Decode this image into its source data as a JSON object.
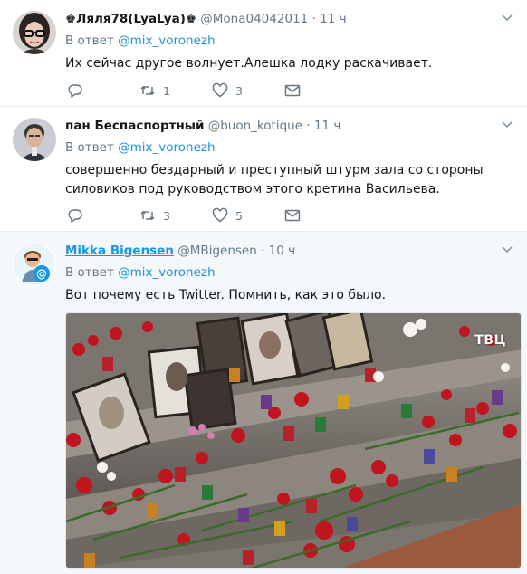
{
  "colors": {
    "accent": "#1b95e0",
    "muted": "#657786",
    "text": "#14171a",
    "border": "#e6ecf0",
    "highlight_bg": "#f5f8fa"
  },
  "tweets": [
    {
      "name": "♚Ляля78(LyaLya)♚",
      "handle": "@Mona04042011",
      "dot": "·",
      "time": "11 ч",
      "reply_prefix": "В ответ",
      "reply_mention": "@mix_voronezh",
      "text": "Их сейчас другое волнует.Алешка лодку раскачивает.",
      "retweets": "1",
      "likes": "3"
    },
    {
      "name": "пан Беспаспортный",
      "handle": "@buon_kotique",
      "dot": "·",
      "time": "11 ч",
      "reply_prefix": "В ответ",
      "reply_mention": "@mix_voronezh",
      "text": "совершенно бездарный и преступный штурм зала со стороны силовиков под руководством этого кретина Васильева.",
      "retweets": "3",
      "likes": "5"
    },
    {
      "name": "Mikka Bigensen",
      "handle": "@MBigensen",
      "dot": "·",
      "time": "10 ч",
      "reply_prefix": "В ответ",
      "reply_mention": "@mix_voronezh",
      "text": "Вот почему есть Twitter. Помнить, как это было.",
      "media_watermark": "ТВЦ"
    }
  ],
  "icons": {
    "caret": "chevron-down-icon",
    "reply": "reply-icon",
    "retweet": "retweet-icon",
    "like": "heart-icon",
    "dm": "envelope-icon"
  }
}
